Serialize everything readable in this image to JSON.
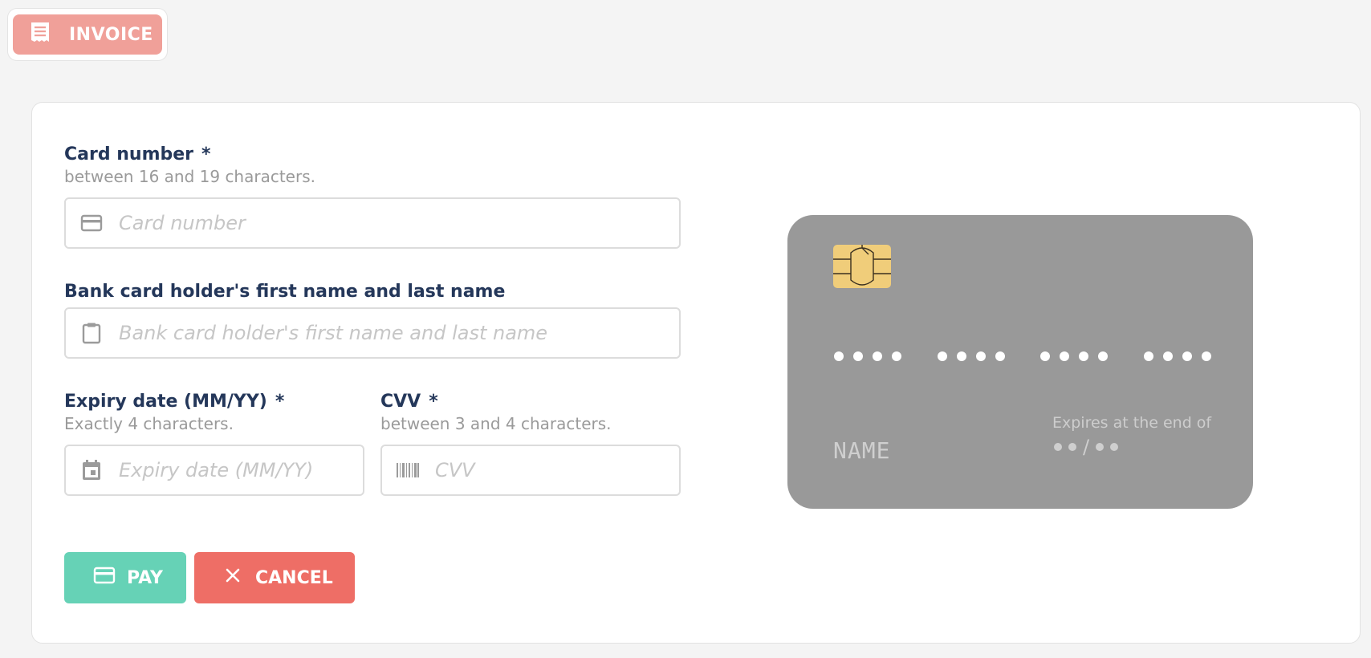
{
  "header": {
    "invoice_label": "INVOICE"
  },
  "form": {
    "card_number": {
      "label": "Card number",
      "required": "*",
      "hint": "between 16 and 19 characters.",
      "placeholder": "Card number"
    },
    "holder": {
      "label": "Bank card holder's first name and last name",
      "placeholder": "Bank card holder's first name and last name"
    },
    "expiry": {
      "label": "Expiry date (MM/YY)",
      "required": "*",
      "hint": "Exactly 4 characters.",
      "placeholder": "Expiry date (MM/YY)"
    },
    "cvv": {
      "label": "CVV",
      "required": "*",
      "hint": "between 3 and 4 characters.",
      "placeholder": "CVV"
    }
  },
  "actions": {
    "pay_label": "PAY",
    "cancel_label": "CANCEL"
  },
  "card_preview": {
    "name": "NAME",
    "expires_label": "Expires at the end of",
    "expiry_separator": "/"
  },
  "colors": {
    "invoice": "#f0a099",
    "pay": "#66d2b6",
    "cancel": "#ee6e66",
    "label": "#24375a",
    "card": "#999999",
    "chip": "#f0cd7a"
  },
  "icons": {
    "invoice": "receipt-icon",
    "card_number": "credit-card-icon",
    "holder": "clipboard-icon",
    "expiry": "calendar-icon",
    "cvv": "barcode-icon",
    "pay": "credit-card-icon",
    "cancel": "close-icon"
  }
}
